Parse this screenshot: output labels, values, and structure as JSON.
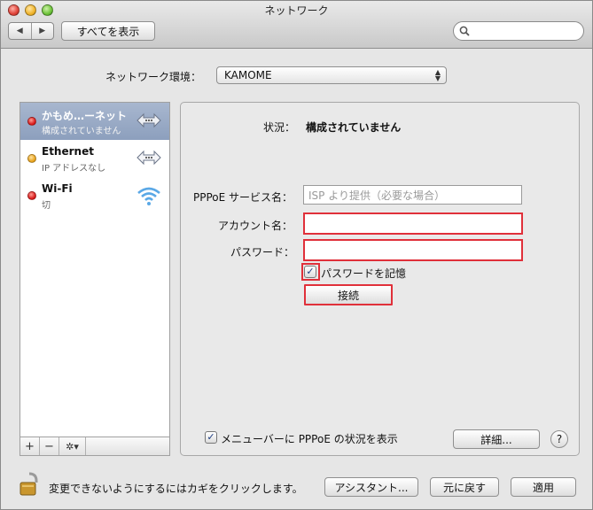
{
  "window": {
    "title": "ネットワーク"
  },
  "toolbar": {
    "back_icon": "◀",
    "forward_icon": "▶",
    "show_all_label": "すべてを表示",
    "search_placeholder": ""
  },
  "location": {
    "label": "ネットワーク環境：",
    "value": "KAMOME"
  },
  "services": [
    {
      "name": "かもめ…ーネット",
      "status": "構成されていません",
      "status_color": "#d81a1a",
      "icon": "ethernet-arrows-icon",
      "selected": true
    },
    {
      "name": "Ethernet",
      "status": "IP アドレスなし",
      "status_color": "#e8a21a",
      "icon": "ethernet-arrows-icon",
      "selected": false
    },
    {
      "name": "Wi-Fi",
      "status": "切",
      "status_color": "#d81a1a",
      "icon": "wifi-icon",
      "selected": false
    }
  ],
  "sidebar_tools": {
    "add": "+",
    "remove": "−",
    "gear": "✲▾"
  },
  "detail": {
    "status_label": "状況：",
    "status_value": "構成されていません",
    "pppoe_service_label": "PPPoE サービス名：",
    "pppoe_service_placeholder": "ISP より提供（必要な場合）",
    "account_label": "アカウント名：",
    "account_value": "",
    "password_label": "パスワード：",
    "password_value": "",
    "remember_password_label": "パスワードを記憶",
    "remember_password_checked": true,
    "connect_label": "接続",
    "show_in_menubar_label": "メニューバーに PPPoE の状況を表示",
    "show_in_menubar_checked": true,
    "advanced_label": "詳細...",
    "help_label": "?"
  },
  "bottom": {
    "lock_text": "変更できないようにするにはカギをクリックします。",
    "assistant_label": "アシスタント...",
    "revert_label": "元に戻す",
    "apply_label": "適用"
  },
  "colors": {
    "highlight": "#e0303a",
    "selection": "#98a8c4"
  }
}
